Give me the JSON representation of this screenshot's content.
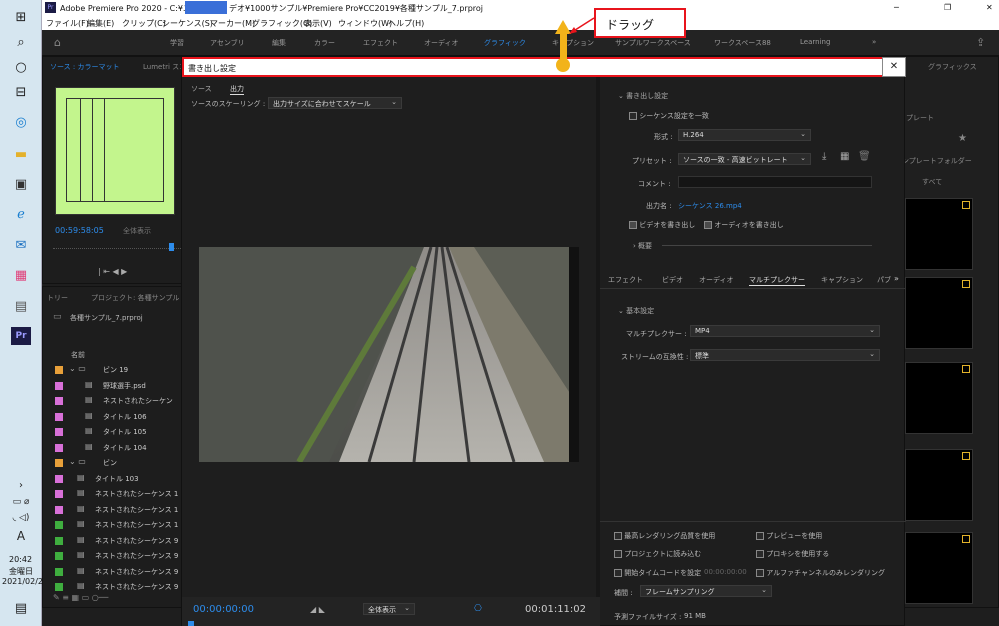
{
  "window": {
    "title": "Adobe Premiere Pro 2020 - C:¥ユーザー¥",
    "title_rest": "デオ¥1000サンプル¥Premiere Pro¥CC2019¥各種サンプル_7.prproj",
    "controls": [
      "─",
      "❐",
      "✕"
    ]
  },
  "menu": [
    "ファイル(F)",
    "編集(E)",
    "クリップ(C)",
    "シーケンス(S)",
    "マーカー(M)",
    "グラフィック(G)",
    "表示(V)",
    "ウィンドウ(W)",
    "ヘルプ(H)"
  ],
  "workspaces": [
    "学習",
    "アセンブリ",
    "編集",
    "カラー",
    "エフェクト",
    "オーディオ",
    "グラフィック",
    "キャプション",
    "サンプルワークスペース",
    "ワークスペース88",
    "Learning"
  ],
  "annotation": {
    "label": "ドラッグ"
  },
  "source_panel": {
    "tab": "ソース : カラーマット",
    "tab2": "Lumetri スコ",
    "timecode": "00:59:58:05",
    "fit": "全体表示"
  },
  "project_panel": {
    "tabs": [
      "トリー",
      "プロジェクト: 各種サンプル"
    ],
    "file": "各種サンプル_7.prproj",
    "column": "名前",
    "items": [
      {
        "label": "ビン 19",
        "color": "#e8a03a",
        "indent": 0
      },
      {
        "label": "野球選手.psd",
        "color": "#d870d8",
        "indent": 2
      },
      {
        "label": "ネストされたシーケン",
        "color": "#d870d8",
        "indent": 2
      },
      {
        "label": "タイトル 106",
        "color": "#d870d8",
        "indent": 2
      },
      {
        "label": "タイトル 105",
        "color": "#d870d8",
        "indent": 2
      },
      {
        "label": "タイトル 104",
        "color": "#d870d8",
        "indent": 2
      },
      {
        "label": "ビン",
        "color": "#e8a03a",
        "indent": 0
      },
      {
        "label": "タイトル 103",
        "color": "#d870d8",
        "indent": 1
      },
      {
        "label": "ネストされたシーケンス 1",
        "color": "#d870d8",
        "indent": 1
      },
      {
        "label": "ネストされたシーケンス 1",
        "color": "#d870d8",
        "indent": 1
      },
      {
        "label": "ネストされたシーケンス 1",
        "color": "#3fae3f",
        "indent": 1
      },
      {
        "label": "ネストされたシーケンス 9",
        "color": "#3fae3f",
        "indent": 1
      },
      {
        "label": "ネストされたシーケンス 9",
        "color": "#3fae3f",
        "indent": 1
      },
      {
        "label": "ネストされたシーケンス 9",
        "color": "#3fae3f",
        "indent": 1
      },
      {
        "label": "ネストされたシーケンス 9",
        "color": "#3fae3f",
        "indent": 1
      }
    ]
  },
  "export_dialog": {
    "title": "書き出し設定",
    "close": "✕",
    "tabs": [
      "ソース",
      "出力"
    ],
    "scaling_label": "ソースのスケーリング :",
    "scaling_value": "出力サイズに合わせてスケール",
    "timecode_start": "00:00:00:00",
    "timecode_end": "00:01:11:02",
    "fit": "全体表示",
    "export_settings": {
      "header": "書き出し設定",
      "match_seq": "シーケンス設定を一致",
      "format_label": "形式 :",
      "format": "H.264",
      "preset_label": "プリセット :",
      "preset": "ソースの一致 - 高速ビットレート",
      "comment_label": "コメント :",
      "output_label": "出力名 :",
      "output": "シーケンス 26.mp4",
      "export_video": "ビデオを書き出し",
      "export_audio": "オーディオを書き出し",
      "summary": "概要"
    },
    "settings_tabs": [
      "エフェクト",
      "ビデオ",
      "オーディオ",
      "マルチプレクサー",
      "キャプション",
      "パブ"
    ],
    "basic": {
      "header": "基本設定",
      "mux_label": "マルチプレクサー :",
      "mux": "MP4",
      "stream_label": "ストリームの互換性 :",
      "stream": "標準"
    },
    "bottom": {
      "max_render": "最高レンダリング品質を使用",
      "preview": "プレビューを使用",
      "import": "プロジェクトに読み込む",
      "proxy": "プロキシを使用する",
      "start_tc": "開始タイムコードを設定",
      "start_tc_val": "00:00:00:00",
      "alpha": "アルファチャンネルのみレンダリング",
      "interp_label": "補間 :",
      "interp": "フレームサンプリング",
      "filesize_label": "予測ファイルサイズ :",
      "filesize": "91 MB"
    }
  },
  "right_panel": {
    "tab": "グラフィックス",
    "labels": [
      "プレート",
      "ンプレートフォルダー",
      "すべて"
    ]
  },
  "clock": {
    "time": "20:42",
    "day": "金曜日",
    "date": "2021/02/26"
  },
  "colors": {
    "accent": "#2d8ceb",
    "red": "#e8141c",
    "marker": "#f2b31a"
  }
}
